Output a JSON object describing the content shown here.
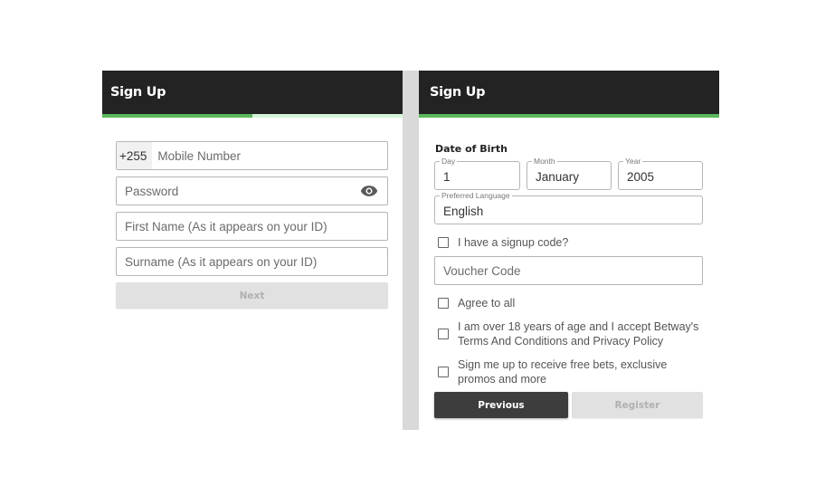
{
  "left_panel": {
    "title": "Sign Up",
    "progress": 0.5,
    "colors": {
      "header": "#232323",
      "progress_fill": "#5cb85c",
      "progress_track": "#d5f5d9"
    },
    "mobile": {
      "prefix": "+255",
      "placeholder": "Mobile Number"
    },
    "password": {
      "placeholder": "Password",
      "icon": "eye-icon"
    },
    "first_name": {
      "placeholder": "First Name (As it appears on your ID)"
    },
    "surname": {
      "placeholder": "Surname (As it appears on your ID)"
    },
    "next_label": "Next"
  },
  "right_panel": {
    "title": "Sign Up",
    "progress": 1.0,
    "dob": {
      "title": "Date of Birth",
      "day": {
        "label": "Day",
        "value": "1"
      },
      "month": {
        "label": "Month",
        "value": "January"
      },
      "year": {
        "label": "Year",
        "value": "2005"
      }
    },
    "language": {
      "label": "Preferred Language",
      "value": "English"
    },
    "signup_code_label": "I have a signup code?",
    "voucher": {
      "placeholder": "Voucher Code"
    },
    "agree_all_label": "Agree to all",
    "terms_label": "I am over 18 years of age and I accept Betway's Terms And Conditions and Privacy Policy",
    "promos_label": "Sign me up to receive free bets, exclusive promos and more",
    "previous_label": "Previous",
    "register_label": "Register"
  }
}
